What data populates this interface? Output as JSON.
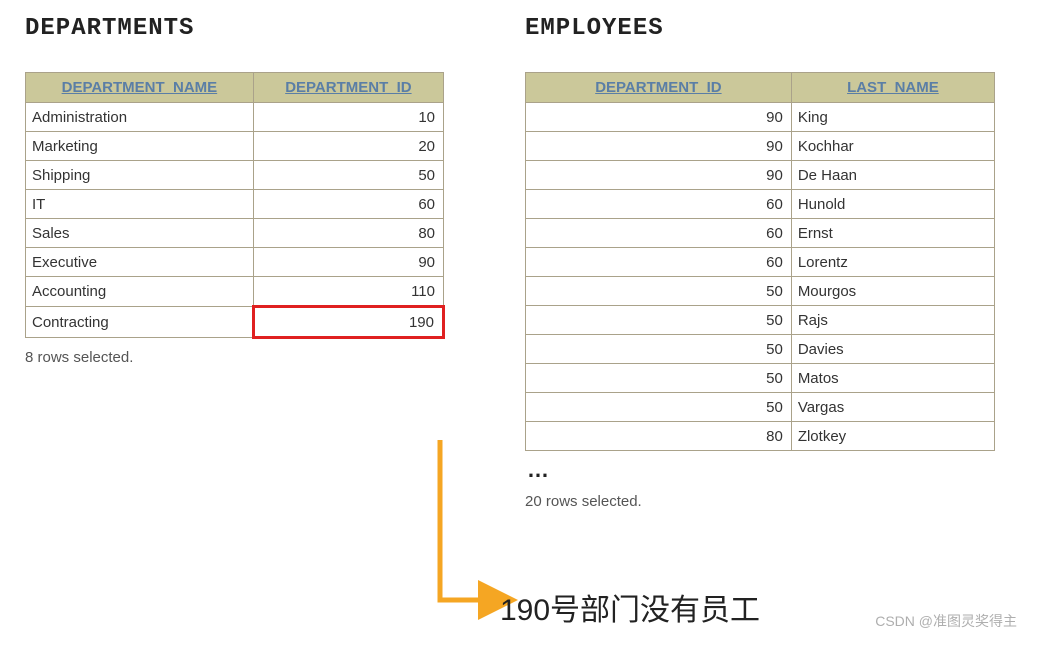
{
  "left": {
    "title": "DEPARTMENTS",
    "columns": [
      "DEPARTMENT_NAME",
      "DEPARTMENT_ID"
    ],
    "rows": [
      {
        "name": "Administration",
        "id": "10",
        "highlight": false
      },
      {
        "name": "Marketing",
        "id": "20",
        "highlight": false
      },
      {
        "name": "Shipping",
        "id": "50",
        "highlight": false
      },
      {
        "name": "IT",
        "id": "60",
        "highlight": false
      },
      {
        "name": "Sales",
        "id": "80",
        "highlight": false
      },
      {
        "name": "Executive",
        "id": "90",
        "highlight": false
      },
      {
        "name": "Accounting",
        "id": "110",
        "highlight": false
      },
      {
        "name": "Contracting",
        "id": "190",
        "highlight": true
      }
    ],
    "footer": "8 rows selected."
  },
  "right": {
    "title": "EMPLOYEES",
    "columns": [
      "DEPARTMENT_ID",
      "LAST_NAME"
    ],
    "rows": [
      {
        "id": "90",
        "name": "King"
      },
      {
        "id": "90",
        "name": "Kochhar"
      },
      {
        "id": "90",
        "name": "De Haan"
      },
      {
        "id": "60",
        "name": "Hunold"
      },
      {
        "id": "60",
        "name": "Ernst"
      },
      {
        "id": "60",
        "name": "Lorentz"
      },
      {
        "id": "50",
        "name": "Mourgos"
      },
      {
        "id": "50",
        "name": "Rajs"
      },
      {
        "id": "50",
        "name": "Davies"
      },
      {
        "id": "50",
        "name": "Matos"
      },
      {
        "id": "50",
        "name": "Vargas"
      },
      {
        "id": "80",
        "name": "Zlotkey"
      }
    ],
    "ellipsis": "…",
    "footer": "20 rows selected."
  },
  "annotation": "190号部门没有员工",
  "watermark": "CSDN @准图灵奖得主",
  "chart_data": {
    "type": "table",
    "tables": [
      {
        "name": "DEPARTMENTS",
        "columns": [
          "DEPARTMENT_NAME",
          "DEPARTMENT_ID"
        ],
        "rows": [
          [
            "Administration",
            10
          ],
          [
            "Marketing",
            20
          ],
          [
            "Shipping",
            50
          ],
          [
            "IT",
            60
          ],
          [
            "Sales",
            80
          ],
          [
            "Executive",
            90
          ],
          [
            "Accounting",
            110
          ],
          [
            "Contracting",
            190
          ]
        ],
        "highlighted_row_index": 7,
        "rows_selected": 8
      },
      {
        "name": "EMPLOYEES",
        "columns": [
          "DEPARTMENT_ID",
          "LAST_NAME"
        ],
        "rows": [
          [
            90,
            "King"
          ],
          [
            90,
            "Kochhar"
          ],
          [
            90,
            "De Haan"
          ],
          [
            60,
            "Hunold"
          ],
          [
            60,
            "Ernst"
          ],
          [
            60,
            "Lorentz"
          ],
          [
            50,
            "Mourgos"
          ],
          [
            50,
            "Rajs"
          ],
          [
            50,
            "Davies"
          ],
          [
            50,
            "Matos"
          ],
          [
            50,
            "Vargas"
          ],
          [
            80,
            "Zlotkey"
          ]
        ],
        "truncated": true,
        "rows_selected": 20
      }
    ],
    "annotation": "190号部门没有员工"
  }
}
